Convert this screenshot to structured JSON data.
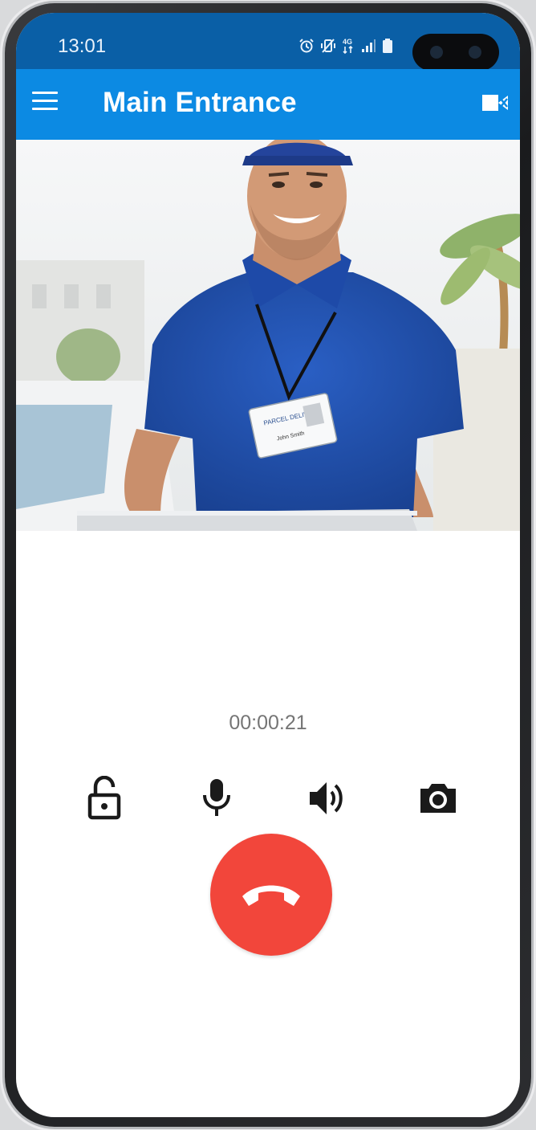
{
  "status_bar": {
    "time": "13:01",
    "icons": [
      "alarm-icon",
      "vibrate-icon",
      "network-4g-icon",
      "signal-icon",
      "battery-icon"
    ]
  },
  "app_bar": {
    "title": "Main Entrance",
    "menu_icon": "hamburger-menu-icon",
    "action_icon": "video-camera-icon"
  },
  "video_feed": {
    "badge_text": "PARCEL DELIVERY",
    "badge_name": "John Smith"
  },
  "call": {
    "duration": "00:00:21"
  },
  "controls": [
    {
      "name": "unlock",
      "icon": "unlock-icon"
    },
    {
      "name": "microphone",
      "icon": "microphone-icon"
    },
    {
      "name": "speaker",
      "icon": "speaker-icon"
    },
    {
      "name": "snapshot",
      "icon": "camera-icon"
    }
  ],
  "hangup": {
    "icon": "phone-hangup-icon"
  },
  "colors": {
    "status_bar": "#0a5fa6",
    "app_bar": "#0c8ae3",
    "hangup": "#f2463b",
    "timer_text": "#757575",
    "icon": "#1a1a1a"
  }
}
